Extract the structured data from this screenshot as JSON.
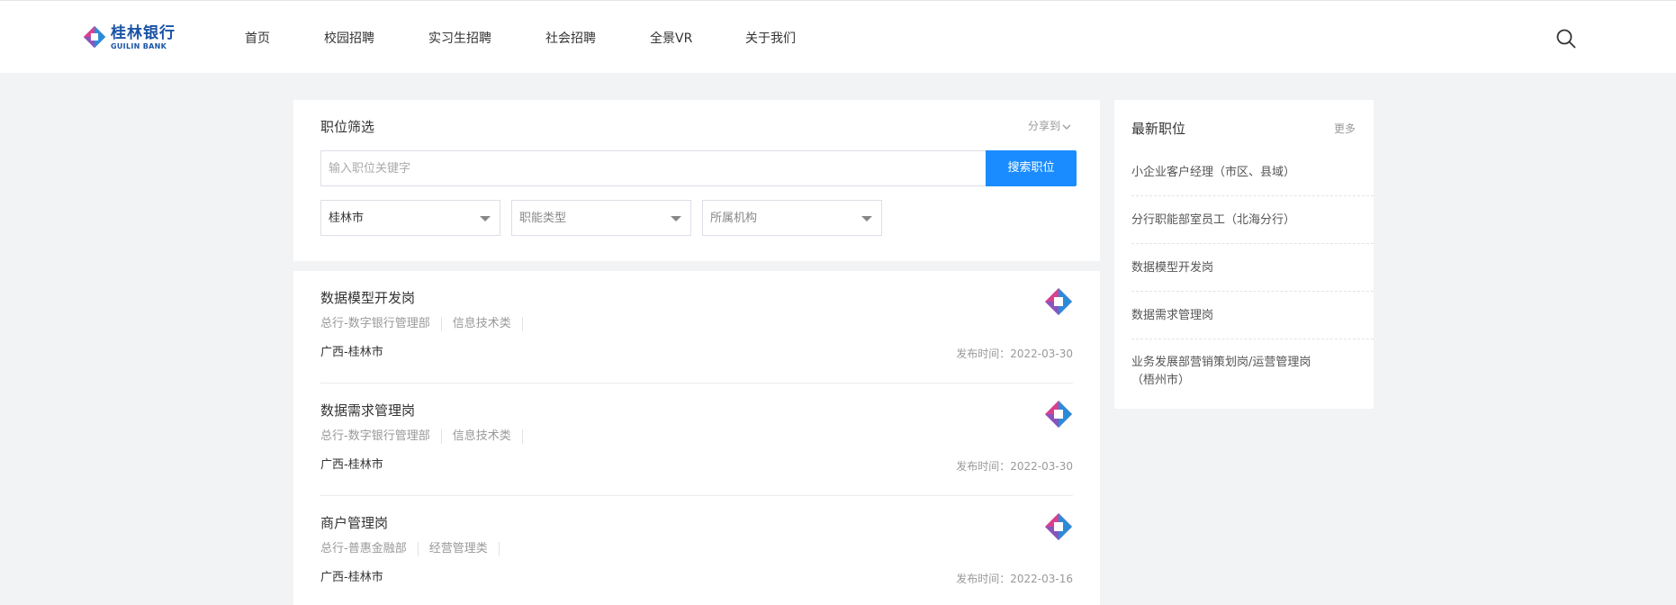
{
  "header": {
    "logo": {
      "cn": "桂林银行",
      "en": "GUILIN BANK"
    },
    "nav": [
      "首页",
      "校园招聘",
      "实习生招聘",
      "社会招聘",
      "全景VR",
      "关于我们"
    ]
  },
  "filter": {
    "title": "职位筛选",
    "share_label": "分享到",
    "search_placeholder": "输入职位关键字",
    "search_button": "搜索职位",
    "selects": [
      {
        "value": "桂林市",
        "placeholder": false
      },
      {
        "value": "职能类型",
        "placeholder": true
      },
      {
        "value": "所属机构",
        "placeholder": true
      }
    ]
  },
  "jobs": [
    {
      "title": "数据模型开发岗",
      "dept": "总行-数字银行管理部",
      "category": "信息技术类",
      "location": "广西-桂林市",
      "date": "发布时间：2022-03-30"
    },
    {
      "title": "数据需求管理岗",
      "dept": "总行-数字银行管理部",
      "category": "信息技术类",
      "location": "广西-桂林市",
      "date": "发布时间：2022-03-30"
    },
    {
      "title": "商户管理岗",
      "dept": "总行-普惠金融部",
      "category": "经营管理类",
      "location": "广西-桂林市",
      "date": "发布时间：2022-03-16"
    }
  ],
  "latest": {
    "title": "最新职位",
    "more": "更多",
    "items": [
      "小企业客户经理（市区、县域）",
      "分行职能部室员工（北海分行）",
      "数据模型开发岗",
      "数据需求管理岗",
      "业务发展部营销策划岗/运营管理岗（梧州市）"
    ]
  },
  "colors": {
    "accent": "#1a8cff",
    "brand_blue": "#1a53a6",
    "brand_pink": "#d8408f",
    "background": "#f2f3f5"
  }
}
